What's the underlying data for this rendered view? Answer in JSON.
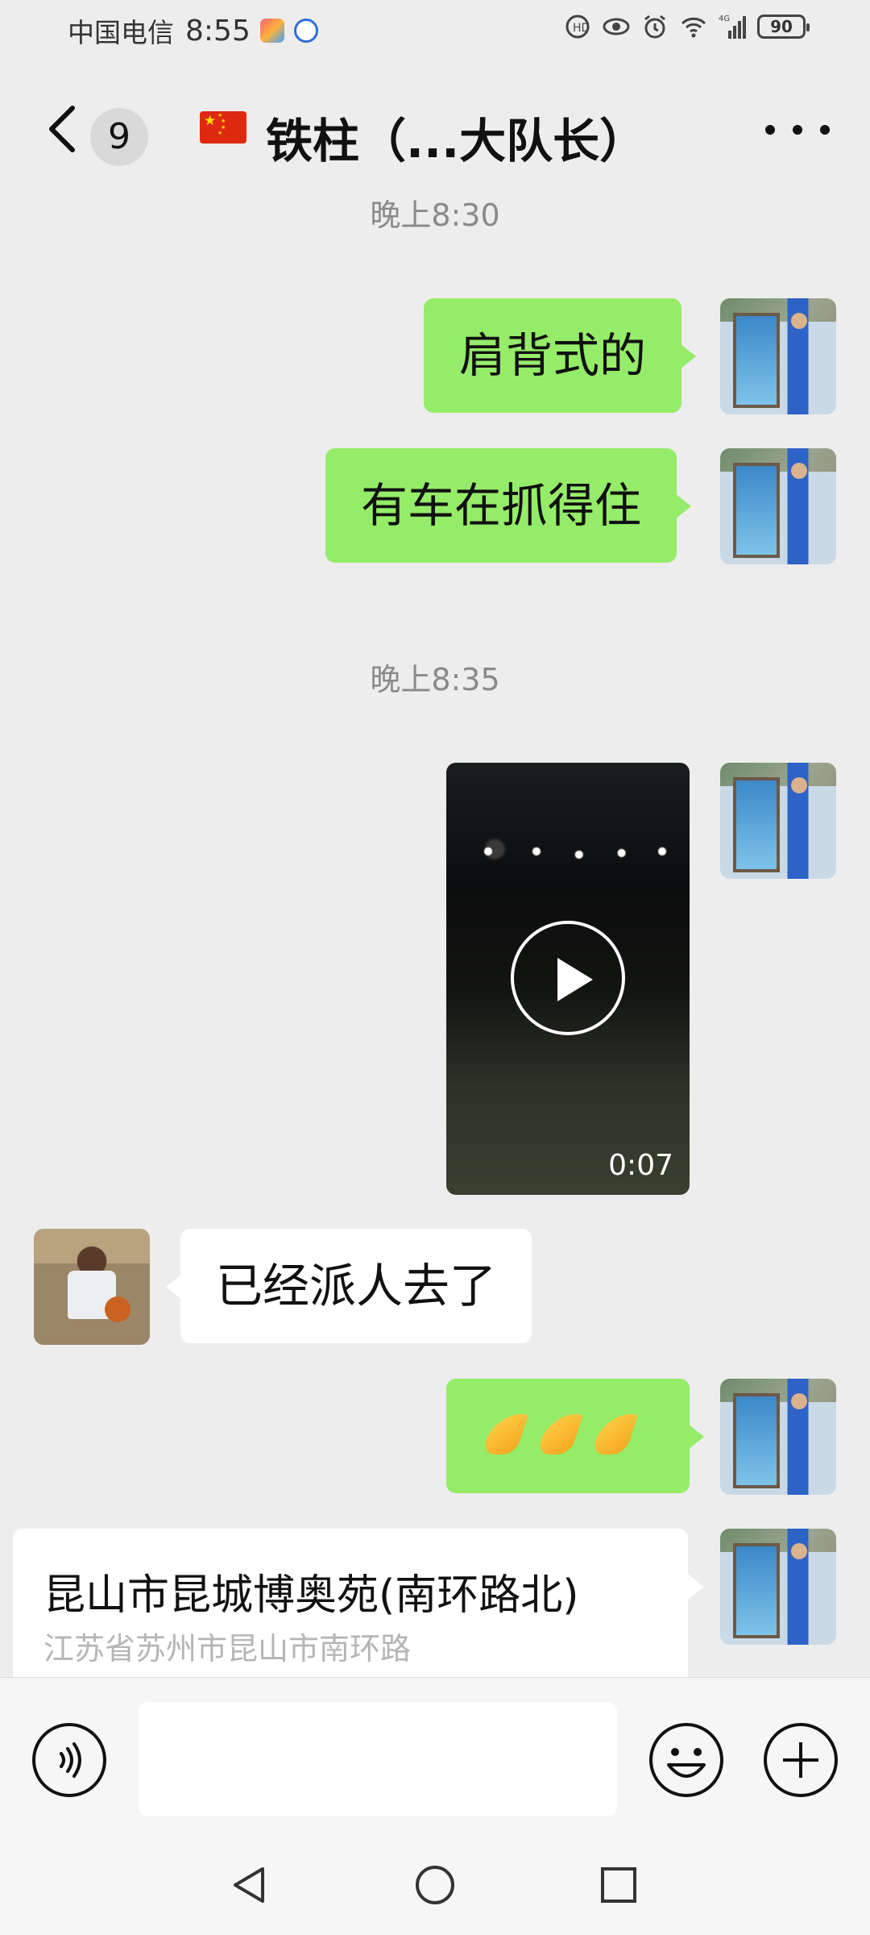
{
  "status_bar": {
    "carrier": "中国电信",
    "time": "8:55",
    "battery": "90",
    "network": "4G",
    "icons": [
      "volte-icon",
      "eye-comfort-icon",
      "alarm-icon",
      "wifi-icon",
      "signal-icon",
      "battery-icon"
    ]
  },
  "header": {
    "back_count": "9",
    "title": "铁柱（...大队长）",
    "flag": "china-flag-emoji"
  },
  "messages": {
    "timestamp_1": "晚上8:30",
    "msg_1": "肩背式的",
    "msg_2": "有车在抓得住",
    "timestamp_2": "晚上8:35",
    "video_duration": "0:07",
    "msg_3": "已经派人去了",
    "msg_4_emoji": "folded-hands-emoji x3",
    "location": {
      "title": "昆山市昆城博奥苑(南环路北)",
      "address": "江苏省苏州市昆山市南环路"
    }
  },
  "input_bar": {
    "voice_icon": "voice-icon",
    "emoji_icon": "emoji-icon",
    "plus_icon": "plus-icon",
    "placeholder": ""
  },
  "colors": {
    "background": "#ededed",
    "sent_bubble": "#95ec69",
    "received_bubble": "#ffffff",
    "timestamp": "#8a8a8a"
  }
}
